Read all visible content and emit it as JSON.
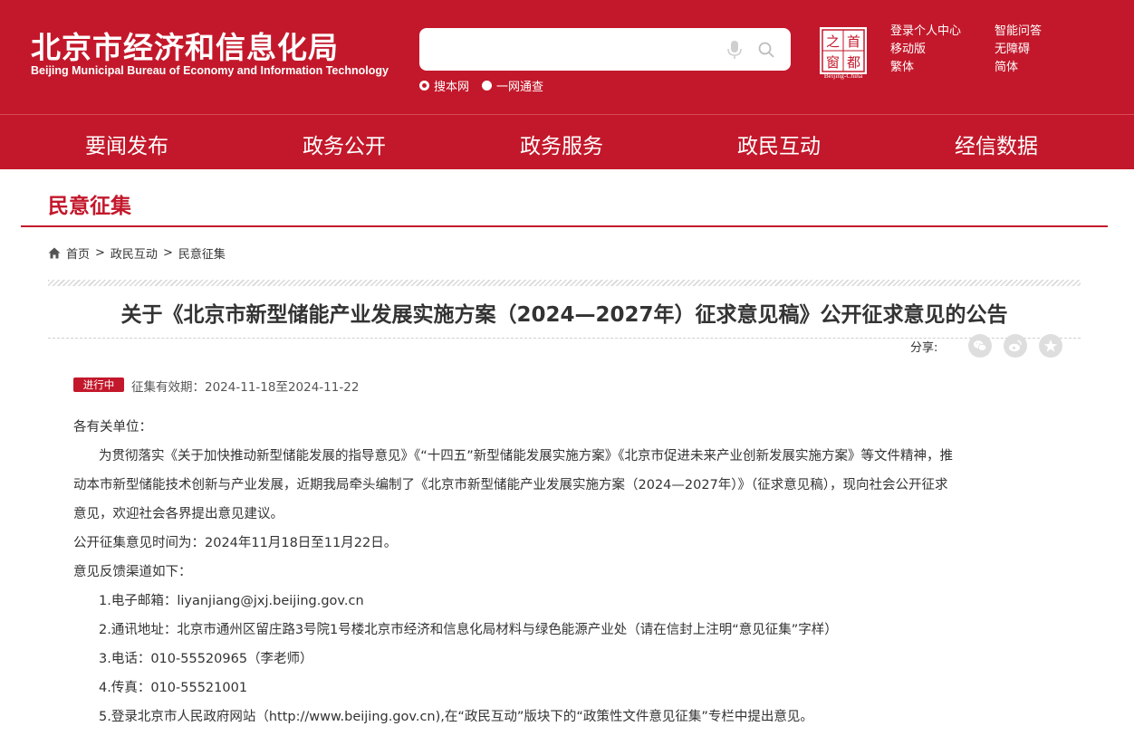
{
  "header": {
    "title": "北京市经济和信息化局",
    "subtitle": "Beijing Municipal Bureau of Economy and Information Technology",
    "search": {
      "placeholder": "",
      "options": [
        "搜本网",
        "一网通查"
      ],
      "selected": "搜本网"
    },
    "logo": {
      "chars": [
        "之",
        "首",
        "窗",
        "都"
      ],
      "caption": "Beijing-China"
    },
    "links": [
      "登录个人中心",
      "智能问答",
      "移动版",
      "无障碍",
      "繁体",
      "简体"
    ]
  },
  "nav": [
    "要闻发布",
    "政务公开",
    "政务服务",
    "政民互动",
    "经信数据"
  ],
  "section_title": "民意征集",
  "breadcrumb": [
    "首页",
    ">",
    "政民互动",
    ">",
    "民意征集"
  ],
  "article": {
    "title": "关于《北京市新型储能产业发展实施方案（2024—2027年）征求意见稿》公开征求意见的公告",
    "share_label": "分享:",
    "status": "进行中",
    "period": "征集有效期：2024-11-18至2024-11-22",
    "salutation": "各有关单位：",
    "para1_line1": "为贯彻落实《关于加快推动新型储能发展的指导意见》《“十四五”新型储能发展实施方案》《北京市促进未来产业创新发展实施方案》等文件精神，推",
    "para1_line2": "动本市新型储能技术创新与产业发展，近期我局牵头编制了《北京市新型储能产业发展实施方案（2024—2027年）》（征求意见稿），现向社会公开征求",
    "para1_line3": "意见，欢迎社会各界提出意见建议。",
    "time_line": "公开征集意见时间为：2024年11月18日至11月22日。",
    "channels_intro": "意见反馈渠道如下：",
    "channels": [
      "1.电子邮箱：liyanjiang@jxj.beijing.gov.cn",
      "2.通讯地址：北京市通州区留庄路3号院1号楼北京市经济和信息化局材料与绿色能源产业处（请在信封上注明“意见征集”字样）",
      "3.电话：010-55520965（李老师）",
      "4.传真：010-55521001",
      "5.登录北京市人民政府网站（http://www.beijing.gov.cn),在“政民互动”版块下的“政策性文件意见征集”专栏中提出意见。"
    ]
  },
  "colors": {
    "brand_red": "#c3182b",
    "text": "#333333",
    "share_grey": "#dedede"
  },
  "icons": [
    "mic-icon",
    "search-icon",
    "home-icon",
    "wechat-icon",
    "weibo-icon",
    "star-icon"
  ]
}
